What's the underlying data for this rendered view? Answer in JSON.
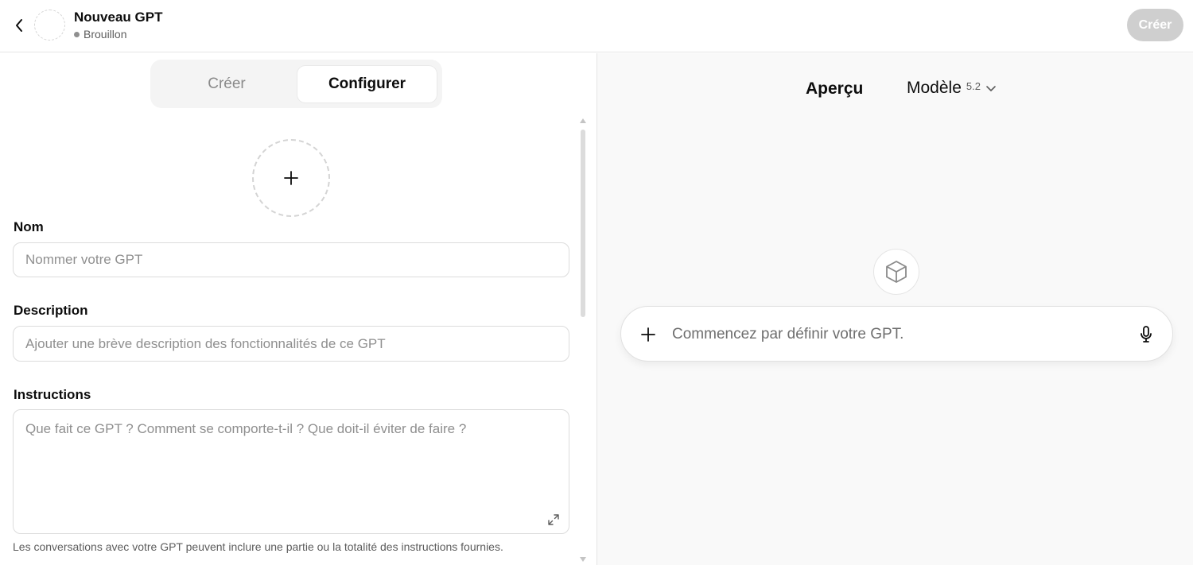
{
  "header": {
    "title": "Nouveau GPT",
    "status": "Brouillon",
    "create_label": "Créer",
    "back_icon": "chevron-left-icon"
  },
  "tabs": [
    {
      "label": "Créer",
      "active": false
    },
    {
      "label": "Configurer",
      "active": true
    }
  ],
  "form": {
    "upload_icon": "plus-icon",
    "name_label": "Nom",
    "name_placeholder": "Nommer votre GPT",
    "description_label": "Description",
    "description_placeholder": "Ajouter une brève description des fonctionnalités de ce GPT",
    "instructions_label": "Instructions",
    "instructions_placeholder": "Que fait ce GPT ? Comment se comporte-t-il ? Que doit-il éviter de faire ?",
    "instructions_hint": "Les conversations avec votre GPT peuvent inclure une partie ou la totalité des instructions fournies."
  },
  "preview": {
    "title": "Aperçu",
    "model_label": "Modèle",
    "model_version": "5.2",
    "gpt_icon": "cube-icon",
    "composer_placeholder": "Commencez par définir votre GPT.",
    "composer_icons": [
      "plus-icon",
      "microphone-icon"
    ]
  },
  "colors": {
    "create_button_bg": "#cfcfcf",
    "right_panel_bg": "#f9f9f9",
    "border": "#e5e5e5"
  }
}
